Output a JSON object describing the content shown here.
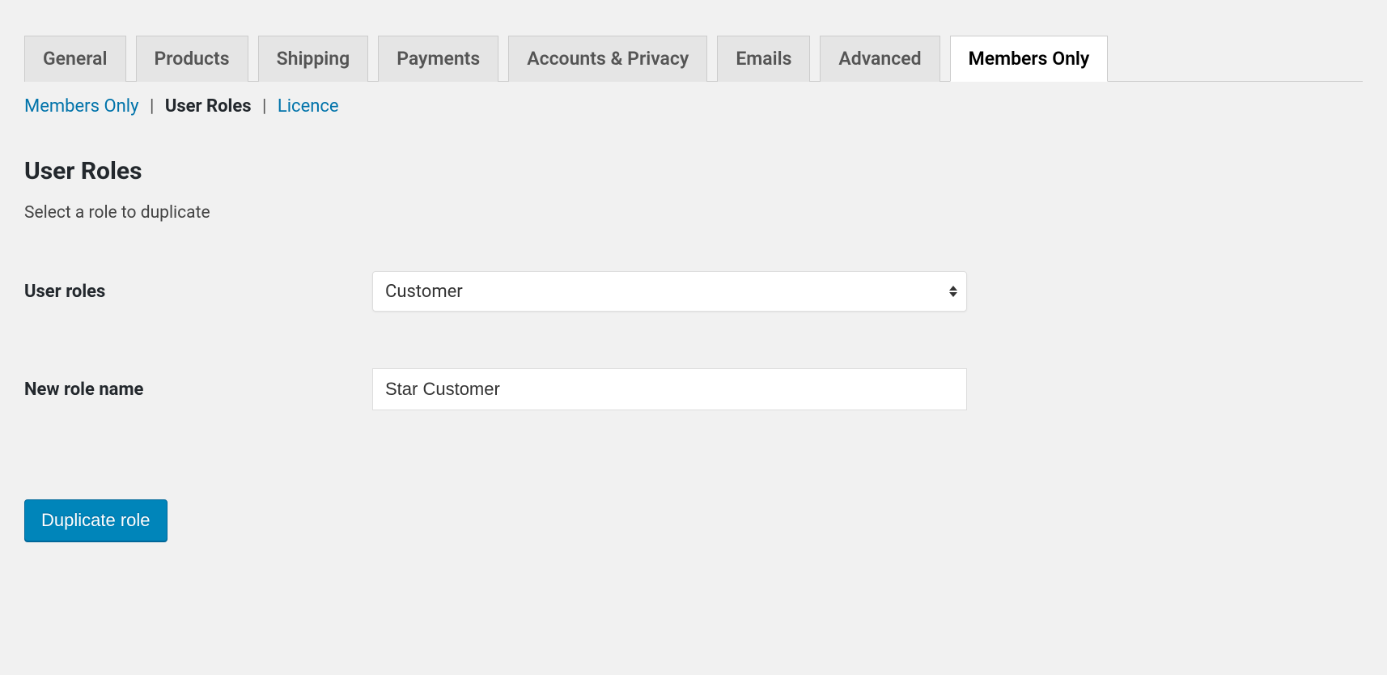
{
  "tabs": [
    {
      "label": "General",
      "active": false
    },
    {
      "label": "Products",
      "active": false
    },
    {
      "label": "Shipping",
      "active": false
    },
    {
      "label": "Payments",
      "active": false
    },
    {
      "label": "Accounts & Privacy",
      "active": false
    },
    {
      "label": "Emails",
      "active": false
    },
    {
      "label": "Advanced",
      "active": false
    },
    {
      "label": "Members Only",
      "active": true
    }
  ],
  "subnav": {
    "items": [
      {
        "label": "Members Only",
        "current": false,
        "link": true
      },
      {
        "label": "User Roles",
        "current": true,
        "link": false
      },
      {
        "label": "Licence",
        "current": false,
        "link": true
      }
    ],
    "separator": "|"
  },
  "section": {
    "title": "User Roles",
    "description": "Select a role to duplicate"
  },
  "form": {
    "user_roles": {
      "label": "User roles",
      "value": "Customer"
    },
    "new_role_name": {
      "label": "New role name",
      "value": "Star Customer"
    },
    "submit_label": "Duplicate role"
  }
}
